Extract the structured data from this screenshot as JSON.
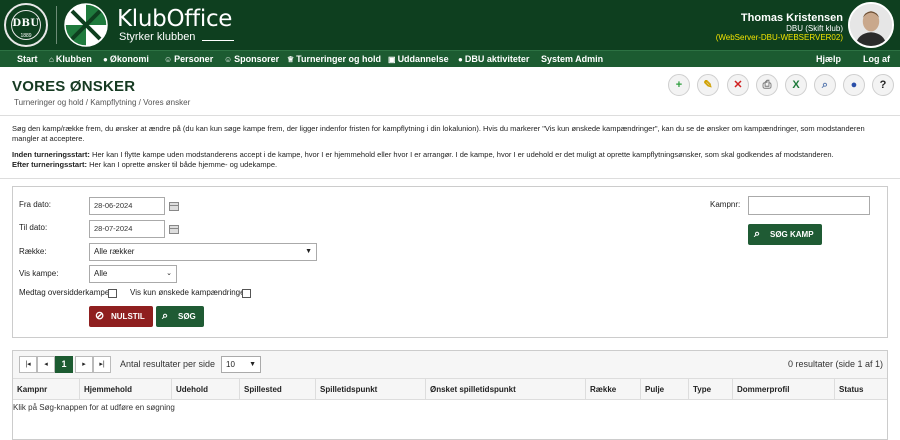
{
  "header": {
    "dbu_logo_text": "DBU",
    "dbu_logo_year": "1889",
    "app_title": "KlubOffice",
    "app_subtitle": "Styrker klubben",
    "user_name": "Thomas Kristensen",
    "user_club": "DBU (Skift klub)",
    "server": "(WebServer-DBU-WEBSERVER02)"
  },
  "nav": {
    "items": [
      {
        "label": "Start",
        "icon": ""
      },
      {
        "label": "Klubben",
        "icon": "⌂"
      },
      {
        "label": "Økonomi",
        "icon": "●"
      },
      {
        "label": "Personer",
        "icon": "☺"
      },
      {
        "label": "Sponsorer",
        "icon": "☺"
      },
      {
        "label": "Turneringer og hold",
        "icon": "♕"
      },
      {
        "label": "Uddannelse",
        "icon": "▣"
      },
      {
        "label": "DBU aktiviteter",
        "icon": "●"
      },
      {
        "label": "System Admin",
        "icon": ""
      }
    ],
    "help": "Hjælp",
    "logout": "Log af"
  },
  "page": {
    "title": "VORES ØNSKER",
    "breadcrumb": "Turneringer og hold / Kampflytning / Vores ønsker"
  },
  "toolbar": [
    {
      "name": "add",
      "glyph": "+",
      "color": "#2e9e3e"
    },
    {
      "name": "edit",
      "glyph": "✎",
      "color": "#d0a000"
    },
    {
      "name": "delete",
      "glyph": "✕",
      "color": "#d02020"
    },
    {
      "name": "print",
      "glyph": "⎙",
      "color": "#777777"
    },
    {
      "name": "excel",
      "glyph": "X",
      "color": "#1d7a3a"
    },
    {
      "name": "search",
      "glyph": "⌕",
      "color": "#5a7ab0"
    },
    {
      "name": "info",
      "glyph": "●",
      "color": "#2a4fa8"
    },
    {
      "name": "help",
      "glyph": "?",
      "color": "#222222"
    }
  ],
  "info": {
    "intro": "Søg den kamp/række frem, du ønsker at ændre på (du kan kun søge kampe frem, der ligger indenfor fristen for kampflytning i din lokalunion). Hvis du markerer \"Vis kun ønskede kampændringer\", kan du se de ønsker om kampændringer, som modstanderen mangler at acceptere.",
    "before_label": "Inden turneringsstart:",
    "before_text": " Her kan I flytte kampe uden modstanderens accept i de kampe, hvor I er hjemmehold eller hvor I er arrangør. I de kampe, hvor I er udehold er det muligt at oprette kampflytningsønsker, som skal godkendes af modstanderen.",
    "after_label": "Efter turneringsstart:",
    "after_text": " Her kan I oprette ønsker til både hjemme- og udekampe."
  },
  "search": {
    "from_label": "Fra dato:",
    "from_value": "28-06-2024",
    "to_label": "Til dato:",
    "to_value": "28-07-2024",
    "row_label": "Række:",
    "row_value": "Alle rækker",
    "show_label": "Vis kampe:",
    "show_value": "Alle",
    "include_label": "Medtag oversidderkampe:",
    "only_label": "Vis kun ønskede kampændringer",
    "match_label": "Kampnr:",
    "match_value": "",
    "search_match_btn": "SØG KAMP",
    "reset_btn": "NULSTIL",
    "search_btn": "SØG"
  },
  "results": {
    "pages": [
      "|◂",
      "◂",
      "1",
      "▸",
      "▸|"
    ],
    "per_page_label": "Antal resultater per side",
    "per_page_value": "10",
    "count": "0 resultater (side 1 af 1)",
    "columns": [
      "Kampnr",
      "Hjemmehold",
      "Udehold",
      "Spillested",
      "Spilletidspunkt",
      "Ønsket spilletidspunkt",
      "Række",
      "Pulje",
      "Type",
      "Dommerprofil",
      "Status"
    ],
    "empty": "Klik på Søg-knappen for at udføre en søgning"
  }
}
